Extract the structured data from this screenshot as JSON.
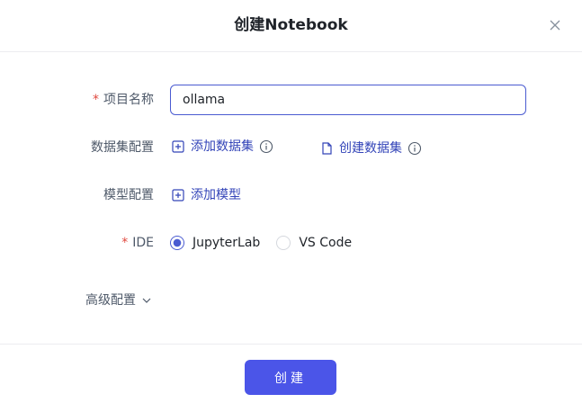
{
  "dialog": {
    "title": "创建Notebook"
  },
  "form": {
    "project_name": {
      "required_mark": "*",
      "label": "项目名称",
      "value": "ollama"
    },
    "dataset_config": {
      "label": "数据集配置",
      "add_dataset_label": "添加数据集",
      "create_dataset_label": "创建数据集"
    },
    "model_config": {
      "label": "模型配置",
      "add_model_label": "添加模型"
    },
    "ide": {
      "required_mark": "*",
      "label": "IDE",
      "options": [
        {
          "label": "JupyterLab",
          "selected": true
        },
        {
          "label": "VS Code",
          "selected": false
        }
      ]
    },
    "advanced": {
      "label": "高级配置"
    }
  },
  "footer": {
    "submit_label": "创建"
  },
  "colors": {
    "accent": "#4b55e8",
    "link": "#3344b8",
    "required": "#e0483e"
  },
  "icons": {
    "close": "close-icon",
    "add": "plus-square-icon",
    "file": "file-icon",
    "info": "info-circle-icon",
    "chevron": "chevron-down-icon"
  }
}
